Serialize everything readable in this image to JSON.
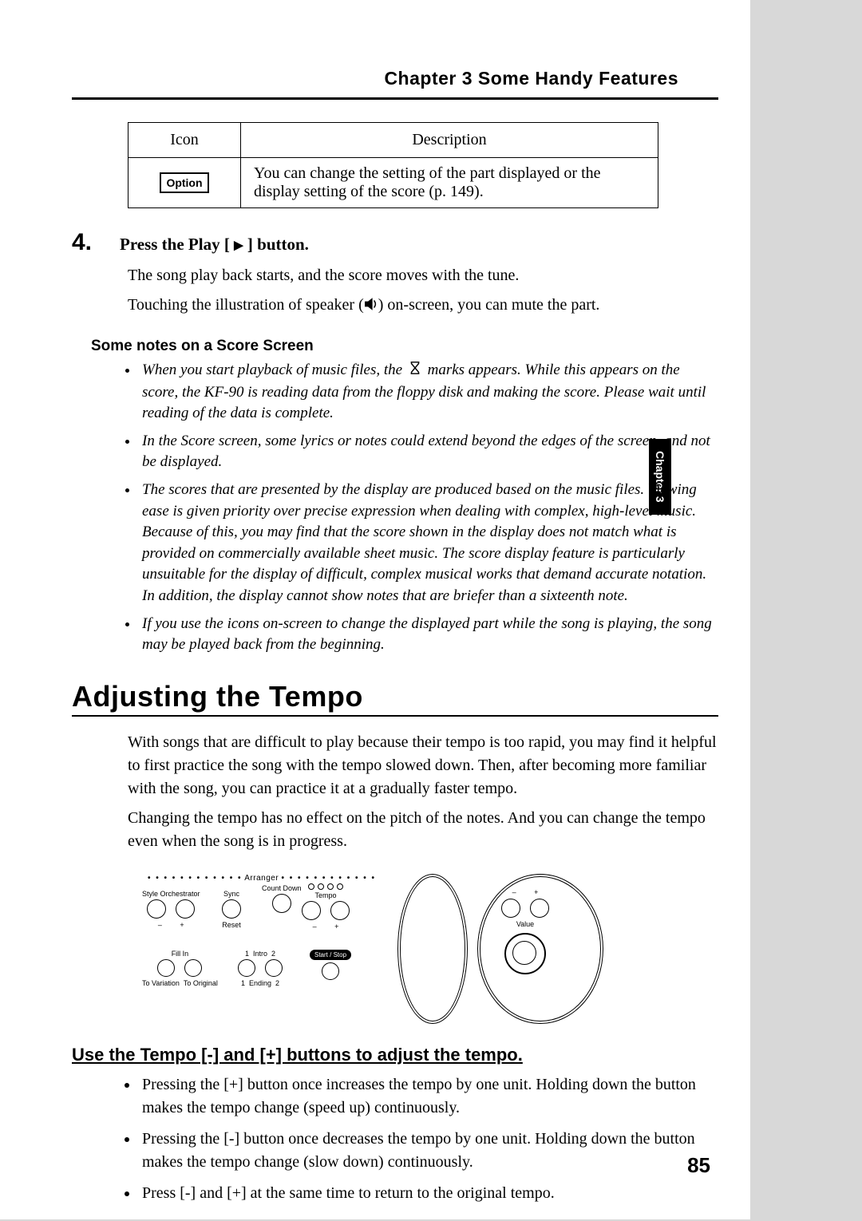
{
  "chapter_header": "Chapter 3  Some Handy Features",
  "sidebar_tab": "Chapter 3",
  "page_number": "85",
  "table": {
    "head_icon": "Icon",
    "head_desc": "Description",
    "icon_label": "Option",
    "desc": "You can change the setting of the part displayed or the display setting of the score (p. 149)."
  },
  "step4": {
    "num": "4.",
    "title_before": "Press the Play [ ",
    "title_after": " ] button.",
    "p1": "The song play back starts, and the score moves with the tune.",
    "p2_before": "Touching the illustration of speaker (",
    "p2_after": ") on-screen, you can mute the part."
  },
  "notes_head": "Some notes on a Score Screen",
  "notes": {
    "n1_a": "When you start playback of music files, the ",
    "n1_b": " marks appears. While this appears on the score, the KF-90 is reading data from the floppy disk and making the score. Please wait until reading of the data is complete.",
    "n2": "In the Score screen, some lyrics or notes could extend beyond the edges of the screen, and not be displayed.",
    "n3": "The scores that are presented by the display are produced based on the music files. Viewing ease is given priority over precise expression when dealing with complex, high-level music. Because of this, you may find that the score shown in the display does not match what is provided on commercially available sheet music. The score display feature is particularly unsuitable for the display of difficult, complex musical works that demand accurate notation. In addition, the display cannot show notes that are briefer than a sixteenth note.",
    "n4": "If you use the icons on-screen to change the displayed part while the song is playing, the song may be played back from the beginning."
  },
  "section_title": "Adjusting the Tempo",
  "intro": {
    "p1": "With songs that are difficult to play because their tempo is too rapid, you may find it helpful to first practice the song with the tempo slowed down. Then, after becoming more familiar with the song, you can practice it at a gradually faster tempo.",
    "p2": "Changing the tempo has no effect on the pitch of the notes. And you can change the tempo even when the song is in progress."
  },
  "diagram": {
    "arranger": "Arranger",
    "style_orch": "Style Orchestrator",
    "sync": "Sync",
    "count_down": "Count\nDown",
    "tempo": "Tempo",
    "reset": "Reset",
    "fill_in": "Fill In",
    "intro": "Intro",
    "start_stop": "Start / Stop",
    "to_variation": "To Variation",
    "to_original": "To Original",
    "ending": "Ending",
    "one": "1",
    "two": "2",
    "minus": "–",
    "plus": "+",
    "value": "Value"
  },
  "subsection": "Use the Tempo [-] and [+] buttons to adjust the tempo.",
  "bullets": {
    "b1": "Pressing the [+] button once increases the tempo by one unit. Holding down the button makes the tempo change (speed up) continuously.",
    "b2": "Pressing the [-] button once decreases the tempo by one unit. Holding down the button makes the tempo change (slow down) continuously.",
    "b3": "Press [-] and [+] at the same time to return to the original tempo."
  }
}
